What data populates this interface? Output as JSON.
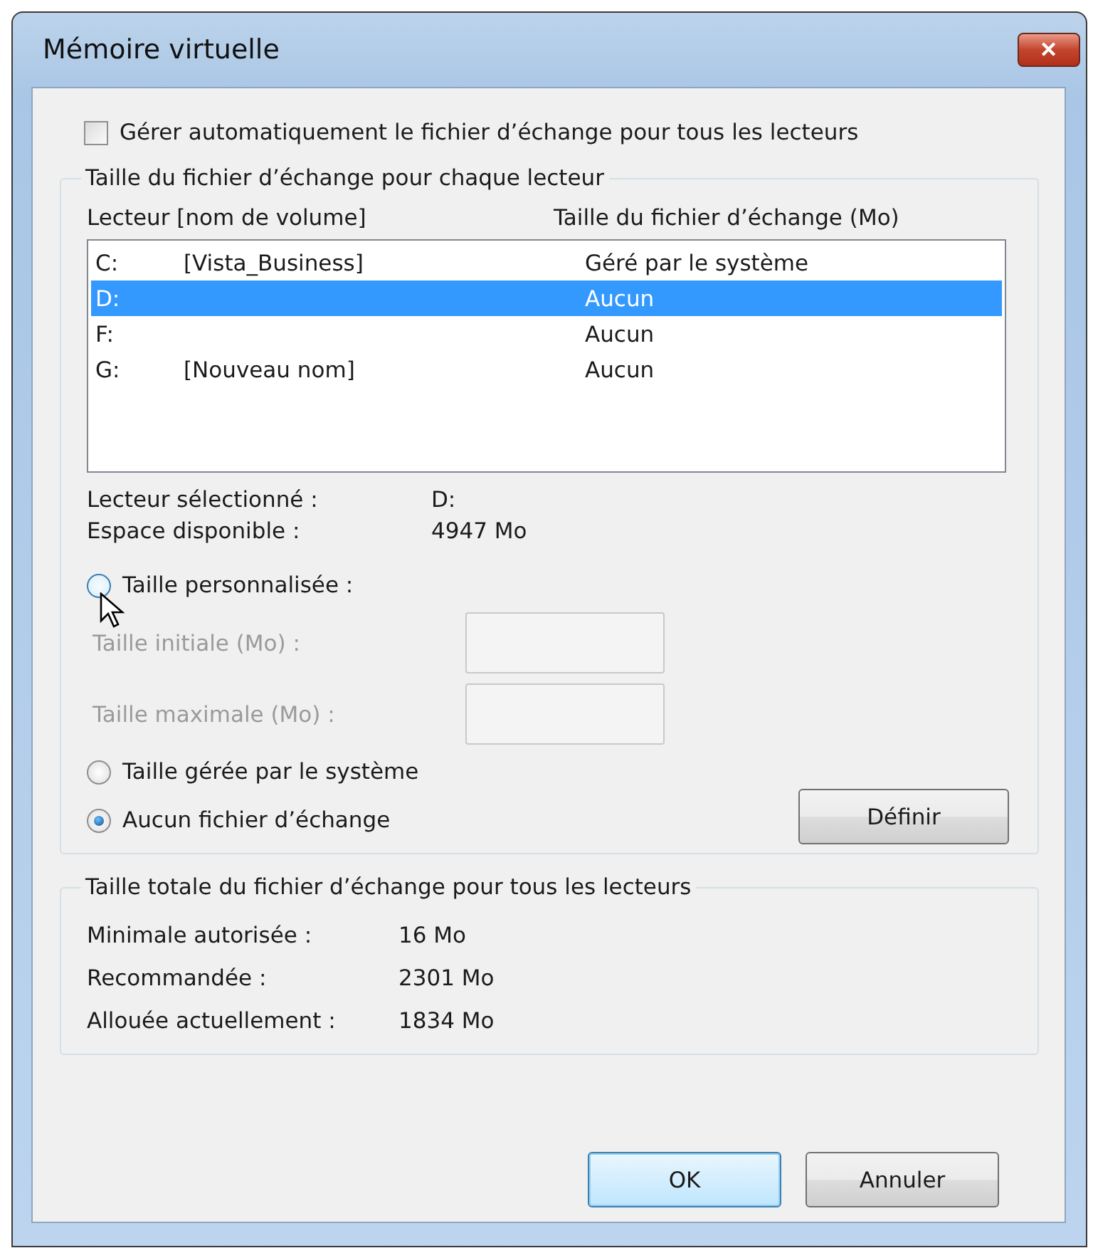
{
  "window": {
    "title": "Mémoire virtuelle",
    "close": "✕"
  },
  "auto_manage": {
    "label": "Gérer automatiquement le fichier d’échange pour tous les lecteurs",
    "checked": false
  },
  "per_drive": {
    "legend": "Taille du fichier d’échange pour chaque lecteur",
    "columns": [
      "Lecteur [nom de volume]",
      "Taille du fichier d’échange (Mo)"
    ],
    "rows": [
      {
        "drive": "C:",
        "volume": "[Vista_Business]",
        "size": "Géré par le système",
        "selected": false
      },
      {
        "drive": "D:",
        "volume": "",
        "size": "Aucun",
        "selected": true
      },
      {
        "drive": "F:",
        "volume": "",
        "size": "Aucun",
        "selected": false
      },
      {
        "drive": "G:",
        "volume": "[Nouveau nom]",
        "size": "Aucun",
        "selected": false
      }
    ],
    "info": [
      {
        "label": "Lecteur sélectionné :",
        "value": "D:"
      },
      {
        "label": "Espace disponible :",
        "value": "4947 Mo"
      }
    ],
    "custom": {
      "label": "Taille personnalisée :",
      "selected": false,
      "hovered": true
    },
    "fields": [
      {
        "label": "Taille initiale (Mo) :",
        "disabled": true
      },
      {
        "label": "Taille maximale (Mo) :",
        "disabled": true
      }
    ],
    "options": [
      {
        "label": "Taille gérée par le système",
        "selected": false
      },
      {
        "label": "Aucun fichier d’échange",
        "selected": true
      }
    ],
    "set_button": "Définir"
  },
  "totals": {
    "legend": "Taille totale du fichier d’échange pour tous les lecteurs",
    "rows": [
      {
        "label": "Minimale autorisée :",
        "value": "16 Mo"
      },
      {
        "label": "Recommandée :",
        "value": "2301 Mo"
      },
      {
        "label": "Allouée actuellement :",
        "value": "1834 Mo"
      }
    ]
  },
  "buttons": [
    {
      "label": "OK",
      "default": true
    },
    {
      "label": "Annuler",
      "default": false
    }
  ]
}
